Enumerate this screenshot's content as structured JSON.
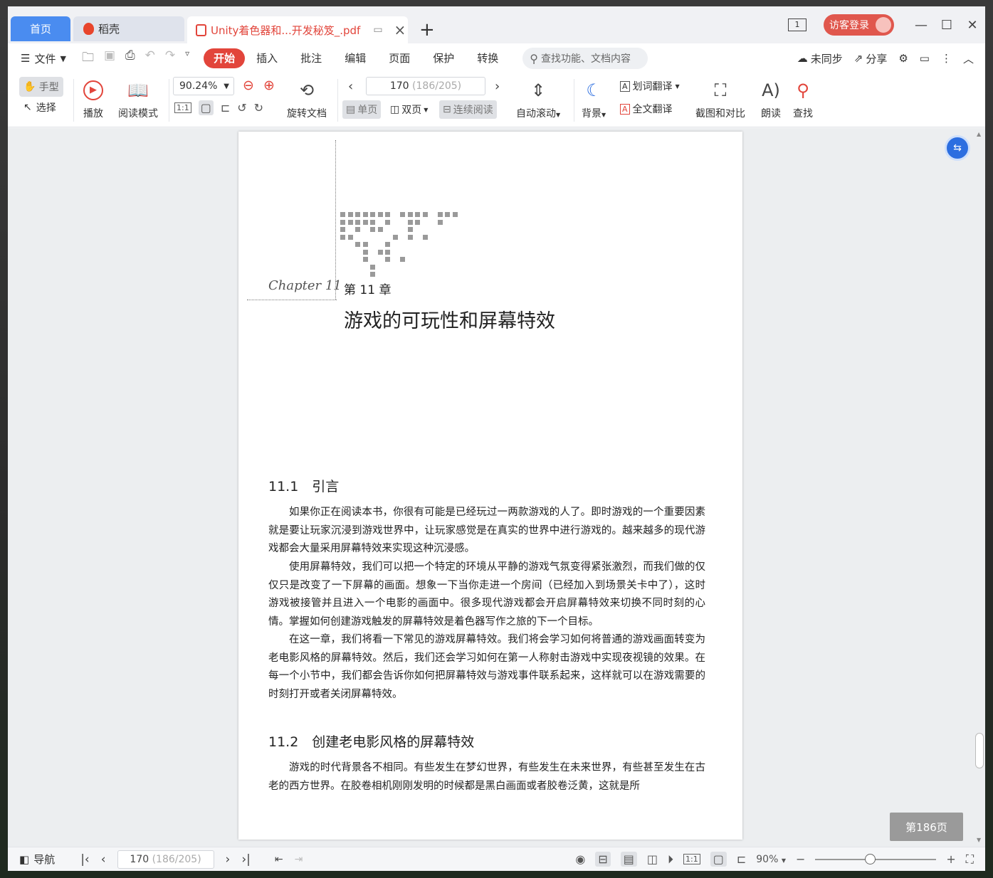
{
  "tabs": {
    "home": "首页",
    "daoke": "稻壳",
    "pdf_title": "Unity着色器和...开发秘笈_.pdf"
  },
  "titlebar": {
    "page_indicator": "1",
    "visitor_login": "访客登录"
  },
  "menu": {
    "file": "文件",
    "tabs": [
      "开始",
      "插入",
      "批注",
      "编辑",
      "页面",
      "保护",
      "转换"
    ],
    "search_placeholder": "查找功能、文档内容",
    "unsync": "未同步",
    "share": "分享"
  },
  "ribbon": {
    "hand": "手型",
    "select": "选择",
    "play": "播放",
    "read_mode": "阅读模式",
    "zoom": "90.24%",
    "rotate": "旋转文档",
    "page_current": "170",
    "page_total": "(186/205)",
    "single": "单页",
    "double": "双页",
    "continuous": "连续阅读",
    "auto_scroll": "自动滚动",
    "background": "背景",
    "word_translate": "划词翻译",
    "full_translate": "全文翻译",
    "screenshot_compare": "截图和对比",
    "read_aloud": "朗读",
    "find": "查找"
  },
  "document": {
    "chapter_script": "Chapter 11",
    "chapter_number": "第 11 章",
    "chapter_title": "游戏的可玩性和屏幕特效",
    "section1": "11.1　引言",
    "p1": "如果你正在阅读本书，你很有可能是已经玩过一两款游戏的人了。即时游戏的一个重要因素就是要让玩家沉浸到游戏世界中，让玩家感觉是在真实的世界中进行游戏的。越来越多的现代游戏都会大量采用屏幕特效来实现这种沉浸感。",
    "p2": "使用屏幕特效，我们可以把一个特定的环境从平静的游戏气氛变得紧张激烈，而我们做的仅仅只是改变了一下屏幕的画面。想象一下当你走进一个房间（已经加入到场景关卡中了），这时游戏被接管并且进入一个电影的画面中。很多现代游戏都会开启屏幕特效来切换不同时刻的心情。掌握如何创建游戏触发的屏幕特效是着色器写作之旅的下一个目标。",
    "p3": "在这一章，我们将看一下常见的游戏屏幕特效。我们将会学习如何将普通的游戏画面转变为老电影风格的屏幕特效。然后，我们还会学习如何在第一人称射击游戏中实现夜视镜的效果。在每一个小节中，我们都会告诉你如何把屏幕特效与游戏事件联系起来，这样就可以在游戏需要的时刻打开或者关闭屏幕特效。",
    "section2": "11.2　创建老电影风格的屏幕特效",
    "p4": "游戏的时代背景各不相同。有些发生在梦幻世界，有些发生在未来世界，有些甚至发生在古老的西方世界。在胶卷相机刚刚发明的时候都是黑白画面或者胶卷泛黄，这就是所"
  },
  "page_badge": "第186页",
  "statusbar": {
    "nav": "导航",
    "page_current": "170",
    "page_total": "(186/205)",
    "zoom": "90%",
    "zoom_level": 0.45
  },
  "icons": {
    "accent_red": "#e2453b",
    "accent_blue": "#4a8cf0"
  }
}
